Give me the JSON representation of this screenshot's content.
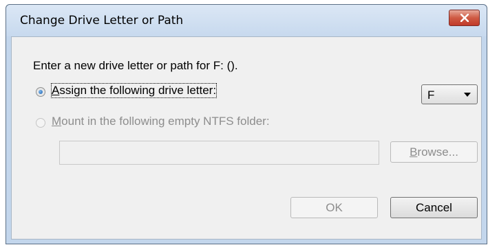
{
  "window": {
    "title": "Change Drive Letter or Path",
    "close_icon": "close-x-icon"
  },
  "dialog": {
    "prompt": "Enter a new drive letter or path for F: ().",
    "assign_option": {
      "mnemonic": "A",
      "rest": "ssign the following drive letter:",
      "checked": true
    },
    "drive_letter": {
      "selected": "F"
    },
    "mount_option": {
      "mnemonic": "M",
      "rest": "ount in the following empty NTFS folder:",
      "checked": false,
      "enabled": false
    },
    "folder_path": {
      "value": ""
    },
    "browse_button": {
      "mnemonic": "B",
      "rest": "rowse..."
    },
    "ok_button": "OK",
    "cancel_button": "Cancel"
  },
  "colors": {
    "frame": "#c3d6ec",
    "client": "#f0f0f0",
    "close_button": "#c0392b",
    "disabled_text": "#8d8d8d"
  }
}
